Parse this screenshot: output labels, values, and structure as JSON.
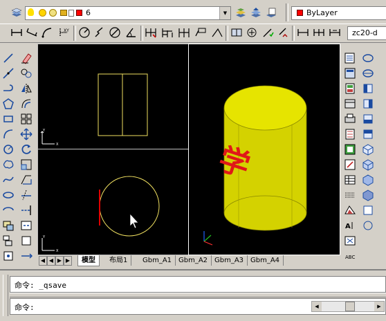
{
  "layer_toolbar": {
    "layer_combo_value": "6",
    "color_combo_value": "ByLayer",
    "style_combo_value": "zc20-d"
  },
  "layout_tabs": [
    "模型",
    "布局1",
    "Gbm_A1",
    "Gbm_A2",
    "Gbm_A3",
    "Gbm_A4"
  ],
  "active_tab_index": 0,
  "command": {
    "history_line": "命令: _qsave",
    "prompt": "命令:",
    "input_value": ""
  },
  "viewport_3d": {
    "cylinder_color": "#d4d200",
    "text_glyph": "学",
    "text_color": "#e01818"
  },
  "colors": {
    "viewport_bg": "#000000",
    "drawing_line": "#f0e060",
    "highlight_line": "#e00000",
    "layer_color_swatch": "#ff0000"
  },
  "icons": {
    "left_column_1": [
      "line-icon",
      "construction-line-icon",
      "polyline-icon",
      "polygon-icon",
      "rectangle-icon",
      "arc-icon",
      "circle-icon",
      "revcloud-icon",
      "spline-icon",
      "ellipse-icon",
      "ellipse-arc-icon",
      "insert-block-icon",
      "make-block-icon",
      "point-icon"
    ],
    "left_column_2": [
      "erase-icon",
      "copy-icon",
      "mirror-icon",
      "offset-icon",
      "array-icon",
      "move-icon",
      "rotate-icon",
      "scale-icon",
      "stretch-icon",
      "trim-icon",
      "extend-icon",
      "break-icon",
      "join-icon",
      "chamfer-icon"
    ],
    "right_column_1": [
      "properties-icon",
      "design-center-icon",
      "tool-palette-icon",
      "sheet-set-icon",
      "markup-icon",
      "calc-icon",
      "dbconnect-icon",
      "block-editor-icon",
      "table-icon",
      "hatch-icon",
      "region-icon",
      "mtext-icon",
      "extrude-icon",
      "revolve-icon"
    ],
    "right_column_2": [
      "view-top-icon",
      "view-bottom-icon",
      "view-left-icon",
      "view-right-icon",
      "view-front-icon",
      "view-back-icon",
      "sw-iso-icon",
      "se-iso-icon",
      "ne-iso-icon",
      "nw-iso-icon",
      "camera-icon",
      "orbit-icon"
    ]
  }
}
